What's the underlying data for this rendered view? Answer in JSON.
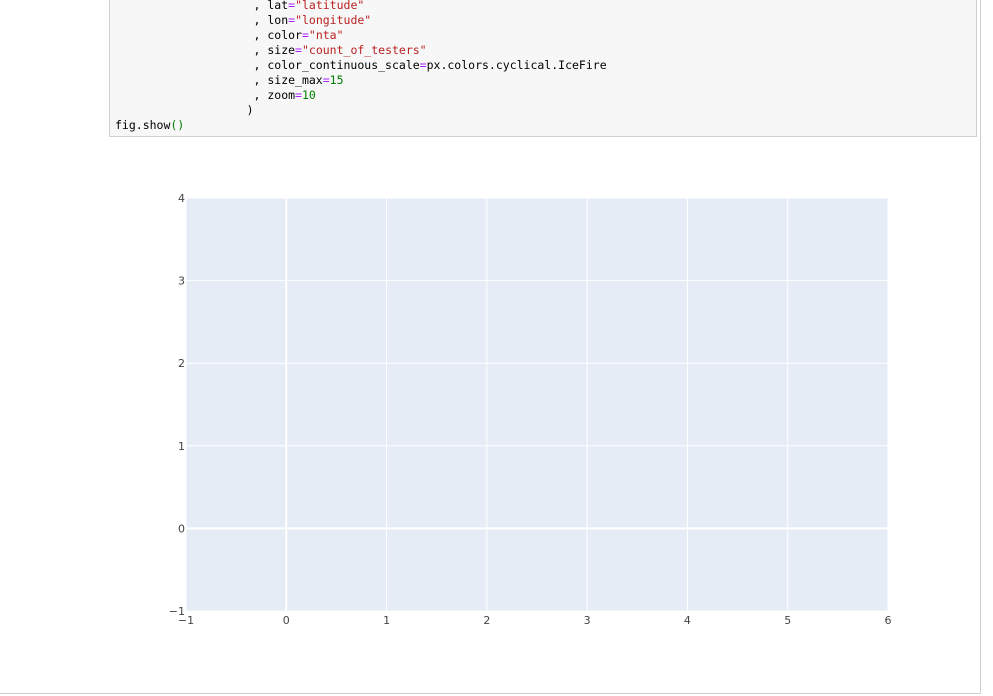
{
  "code_cell": {
    "lines": [
      {
        "indent": "                    ",
        "prefix": ", ",
        "key": "lat",
        "value": "\"latitude\"",
        "value_type": "str"
      },
      {
        "indent": "                    ",
        "prefix": ", ",
        "key": "lon",
        "value": "\"longitude\"",
        "value_type": "str"
      },
      {
        "indent": "                    ",
        "prefix": ", ",
        "key": "color",
        "value": "\"nta\"",
        "value_type": "str"
      },
      {
        "indent": "                    ",
        "prefix": ", ",
        "key": "size",
        "value": "\"count_of_testers\"",
        "value_type": "str"
      },
      {
        "indent": "                    ",
        "prefix": ", ",
        "key": "color_continuous_scale",
        "value": "px.colors.cyclical.IceFire",
        "value_type": "plain"
      },
      {
        "indent": "                    ",
        "prefix": ", ",
        "key": "size_max",
        "value": "15",
        "value_type": "num"
      },
      {
        "indent": "                    ",
        "prefix": ", ",
        "key": "zoom",
        "value": "10",
        "value_type": "num"
      },
      {
        "indent": "                   ",
        "prefix": ")",
        "key": "",
        "value": "",
        "value_type": "close"
      },
      {
        "indent": "",
        "prefix": "fig.show",
        "key": "",
        "value": "()",
        "value_type": "call"
      }
    ]
  },
  "chart_data": {
    "type": "scatter",
    "x": [],
    "y": [],
    "xlim": [
      -1,
      6
    ],
    "ylim": [
      -1,
      4
    ],
    "x_ticks": [
      -1,
      0,
      1,
      2,
      3,
      4,
      5,
      6
    ],
    "y_ticks": [
      -1,
      0,
      1,
      2,
      3,
      4
    ],
    "x_tick_labels": [
      "−1",
      "0",
      "1",
      "2",
      "3",
      "4",
      "5",
      "6"
    ],
    "y_tick_labels": [
      "−1",
      "0",
      "1",
      "2",
      "3",
      "4"
    ],
    "grid": true,
    "plot_bg": "#e5ecf6",
    "grid_color": "#ffffff"
  }
}
